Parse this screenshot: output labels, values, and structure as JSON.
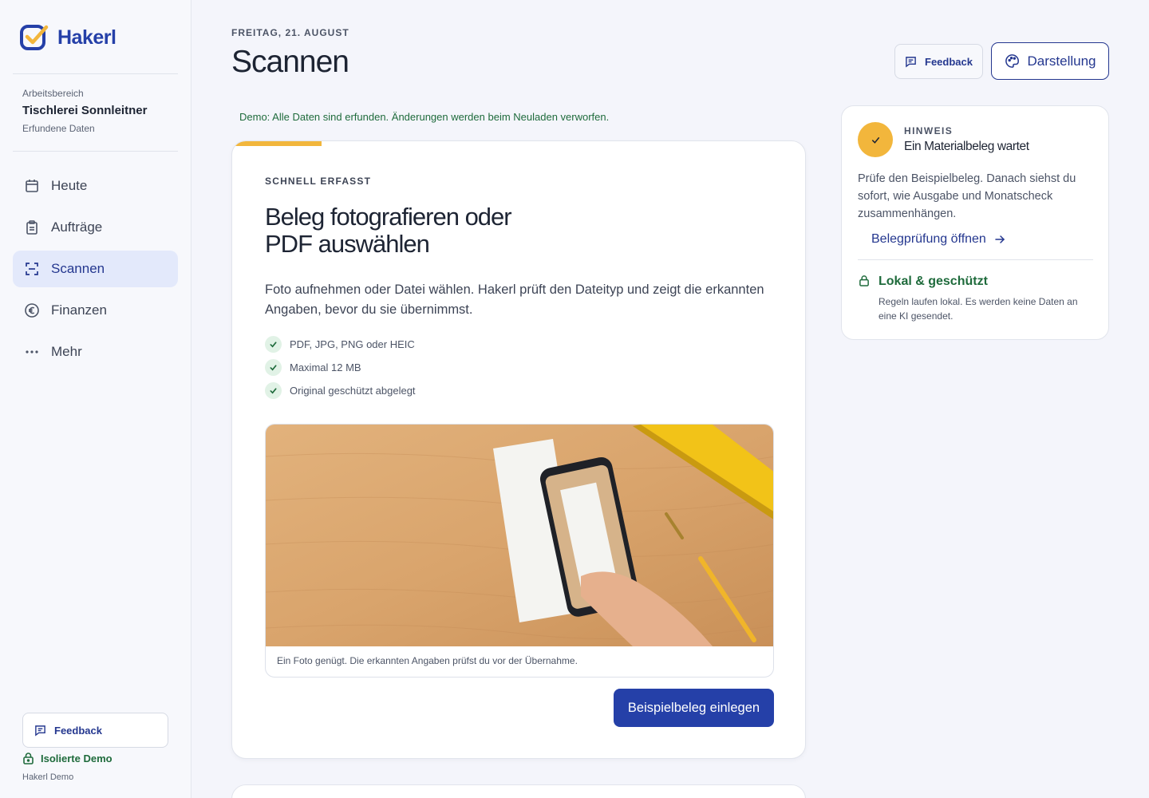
{
  "brand": {
    "name": "Hakerl",
    "logo_icon": "checkbox-logo-icon"
  },
  "workspace": {
    "label": "Arbeitsbereich",
    "name": "Tischlerei Sonnleitner",
    "sub": "Erfundene Daten"
  },
  "nav": {
    "items": [
      {
        "label": "Heute",
        "icon": "calendar-icon",
        "active": false
      },
      {
        "label": "Aufträge",
        "icon": "clipboard-icon",
        "active": false
      },
      {
        "label": "Scannen",
        "icon": "scan-icon",
        "active": true
      },
      {
        "label": "Finanzen",
        "icon": "euro-icon",
        "active": false
      },
      {
        "label": "Mehr",
        "icon": "more-icon",
        "active": false
      }
    ]
  },
  "sidebar_footer": {
    "feedback_label": "Feedback",
    "isolated_label": "Isolierte Demo",
    "foot_text": "Hakerl Demo"
  },
  "header": {
    "date": "FREITAG, 21. AUGUST",
    "title": "Scannen",
    "feedback_label": "Feedback",
    "appearance_label": "Darstellung"
  },
  "demo_note": "Demo: Alle Daten sind erfunden. Änderungen werden beim Neuladen verworfen.",
  "scan_card": {
    "eyebrow": "SCHNELL ERFASST",
    "title": "Beleg fotografieren oder PDF auswählen",
    "description": "Foto aufnehmen oder Datei wählen. Hakerl prüft den Dateityp und zeigt die erkannten Angaben, bevor du sie übernimmst.",
    "checklist": [
      "PDF, JPG, PNG oder HEIC",
      "Maximal 12 MB",
      "Original geschützt abgelegt"
    ],
    "caption": "Ein Foto genügt. Die erkannten Angaben prüfst du vor der Übernahme.",
    "primary_button": "Beispielbeleg einlegen"
  },
  "hint": {
    "eyebrow": "HINWEIS",
    "title": "Ein Materialbeleg wartet",
    "text": "Prüfe den Beispielbeleg. Danach siehst du sofort, wie Ausgabe und Monatscheck zusammenhängen.",
    "link_label": "Belegprüfung öffnen",
    "safe_title": "Lokal & geschützt",
    "safe_text": "Regeln laufen lokal. Es werden keine Daten an eine KI gesendet."
  },
  "colors": {
    "brand_blue": "#2540a8",
    "accent_yellow": "#f2b63c",
    "success_green": "#1f6b3c",
    "active_nav_bg": "#e3e9fb"
  }
}
